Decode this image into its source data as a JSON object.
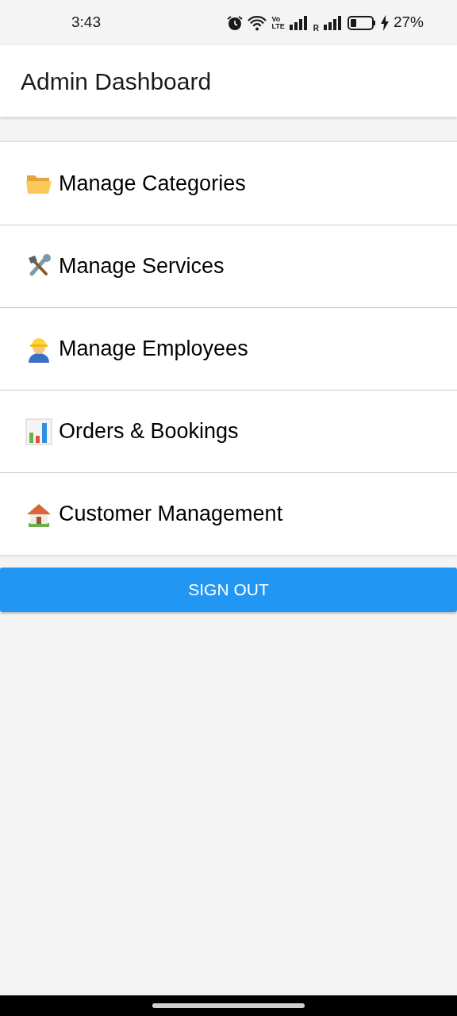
{
  "status_bar": {
    "time": "3:43",
    "volte_top": "Vo",
    "volte_bottom": "LTE",
    "roaming": "R",
    "battery": "27%"
  },
  "app_bar": {
    "title": "Admin Dashboard"
  },
  "menu": [
    {
      "kind": "folder",
      "label": "Manage Categories"
    },
    {
      "kind": "tools",
      "label": "Manage Services"
    },
    {
      "kind": "worker",
      "label": "Manage Employees"
    },
    {
      "kind": "chart",
      "label": "Orders & Bookings"
    },
    {
      "kind": "house",
      "label": "Customer Management"
    }
  ],
  "sign_out": {
    "label": "SIGN OUT"
  }
}
